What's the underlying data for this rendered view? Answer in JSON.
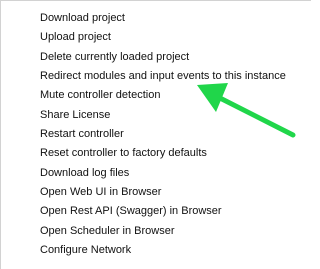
{
  "context_menu": {
    "items": [
      {
        "label": "Download project"
      },
      {
        "label": "Upload project"
      },
      {
        "label": "Delete currently loaded project"
      },
      {
        "label": "Redirect modules and input events to this instance"
      },
      {
        "label": "Mute controller detection"
      },
      {
        "label": "Share License"
      },
      {
        "label": "Restart controller"
      },
      {
        "label": "Reset controller to factory defaults"
      },
      {
        "label": "Download log files"
      },
      {
        "label": "Open Web UI in Browser"
      },
      {
        "label": "Open Rest API (Swagger) in Browser"
      },
      {
        "label": "Open Scheduler in Browser"
      },
      {
        "label": "Configure Network"
      }
    ]
  },
  "annotation": {
    "arrow_color": "#20d64a",
    "arrow_icon": "arrow-annotation-icon"
  }
}
